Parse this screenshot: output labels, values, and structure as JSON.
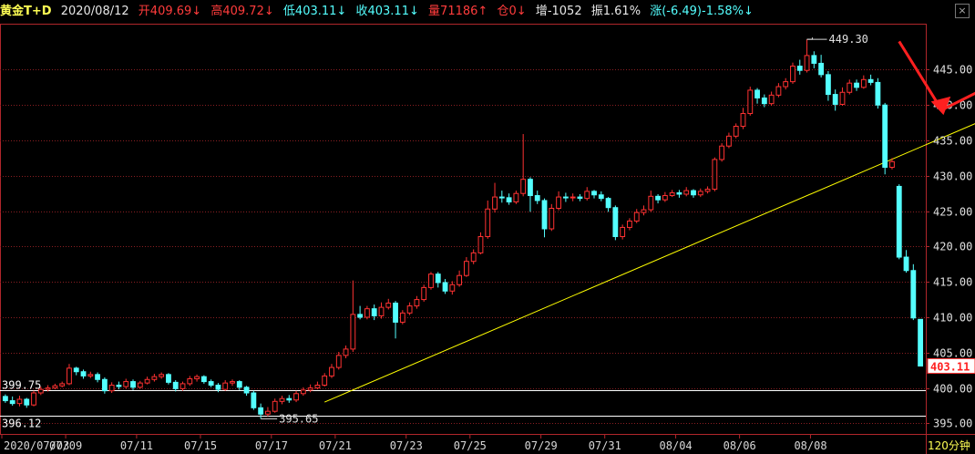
{
  "header": {
    "symbol": "黄金T+D",
    "date": "2020/08/12",
    "open_label": "开",
    "open": "409.69",
    "high_label": "高",
    "high": "409.72",
    "low_label": "低",
    "low": "403.11",
    "close_label": "收",
    "close": "403.11",
    "volume_label": "量",
    "volume": "71186",
    "position_label": "仓",
    "position": "0",
    "increase_label": "增",
    "increase": "-1052",
    "amplitude_label": "振",
    "amplitude": "1.61%",
    "change_label": "涨",
    "change": "(-6.49)-1.58%",
    "up_arrow": "↑",
    "down_arrow": "↓"
  },
  "period_label": "120分钟",
  "colors": {
    "up": "#ff3232",
    "down": "#54ffff",
    "axis": "#b0262b",
    "text_up": "#ff3c3c",
    "text_down": "#54ffff",
    "yellow": "#ffff00"
  },
  "chart_data": {
    "type": "candlestick",
    "period": "120分钟",
    "y_ticks": [
      395,
      400,
      405,
      410,
      415,
      420,
      425,
      430,
      435,
      440,
      445
    ],
    "y_tick_labels": [
      "395.00",
      "400.00",
      "405.00",
      "410.00",
      "415.00",
      "420.00",
      "425.00",
      "430.00",
      "435.00",
      "440.00",
      "445.00"
    ],
    "ylim": [
      393.5,
      451.5
    ],
    "x_labels": [
      "2020/07/03",
      "07/09",
      "07/11",
      "07/15",
      "07/17",
      "07/21",
      "07/23",
      "07/25",
      "07/29",
      "07/31",
      "08/04",
      "08/06",
      "08/08"
    ],
    "x_label_index": [
      0,
      9,
      19,
      28,
      38,
      47,
      57,
      66,
      76,
      85,
      95,
      104,
      114
    ],
    "current_price": "403.11",
    "reference_lines": [
      {
        "value": 399.75,
        "label": "399.75"
      },
      {
        "value": 396.12,
        "label": "396.12"
      }
    ],
    "annotations": [
      {
        "label": "449.30",
        "value": 449.3,
        "type": "max"
      },
      {
        "label": "395.65",
        "value": 395.65,
        "type": "min"
      }
    ],
    "candles": [
      [
        398.8,
        398.2,
        399.1,
        397.9
      ],
      [
        398.2,
        397.8,
        398.8,
        397.5
      ],
      [
        397.8,
        398.4,
        398.9,
        397.4
      ],
      [
        398.4,
        397.6,
        398.6,
        397.2
      ],
      [
        397.6,
        399.3,
        399.6,
        397.4
      ],
      [
        399.3,
        399.8,
        400.2,
        399.0
      ],
      [
        399.8,
        400.0,
        400.4,
        399.5
      ],
      [
        400.0,
        400.3,
        400.6,
        399.8
      ],
      [
        400.3,
        400.6,
        400.9,
        400.1
      ],
      [
        400.6,
        402.8,
        403.4,
        400.4
      ],
      [
        402.8,
        402.3,
        403.0,
        401.8
      ],
      [
        402.3,
        401.7,
        402.6,
        401.3
      ],
      [
        401.7,
        401.9,
        402.3,
        401.4
      ],
      [
        401.9,
        401.2,
        402.2,
        400.8
      ],
      [
        401.2,
        399.6,
        401.5,
        399.2
      ],
      [
        399.6,
        400.4,
        400.8,
        399.3
      ],
      [
        400.4,
        400.2,
        400.9,
        399.8
      ],
      [
        400.2,
        400.9,
        401.3,
        399.9
      ],
      [
        400.9,
        400.1,
        401.2,
        399.7
      ],
      [
        400.1,
        400.7,
        401.0,
        399.9
      ],
      [
        400.7,
        401.2,
        401.6,
        400.5
      ],
      [
        401.2,
        401.6,
        402.0,
        400.9
      ],
      [
        401.6,
        401.9,
        402.2,
        401.3
      ],
      [
        401.9,
        400.8,
        402.1,
        400.5
      ],
      [
        400.8,
        399.9,
        401.1,
        399.5
      ],
      [
        399.9,
        400.6,
        400.9,
        399.6
      ],
      [
        400.6,
        401.3,
        401.7,
        400.3
      ],
      [
        401.3,
        401.6,
        401.9,
        400.9
      ],
      [
        401.6,
        400.9,
        401.8,
        400.6
      ],
      [
        400.9,
        400.4,
        401.2,
        400.1
      ],
      [
        400.4,
        399.8,
        400.7,
        399.4
      ],
      [
        399.8,
        400.7,
        401.1,
        399.6
      ],
      [
        400.7,
        400.9,
        401.2,
        400.3
      ],
      [
        400.9,
        400.1,
        401.1,
        399.7
      ],
      [
        400.1,
        399.3,
        400.3,
        398.9
      ],
      [
        399.3,
        397.2,
        399.6,
        396.9
      ],
      [
        397.2,
        396.3,
        397.8,
        395.65
      ],
      [
        396.3,
        396.7,
        397.3,
        396.0
      ],
      [
        396.7,
        398.1,
        398.5,
        396.5
      ],
      [
        398.1,
        398.5,
        398.9,
        397.7
      ],
      [
        398.5,
        398.3,
        399.0,
        397.9
      ],
      [
        398.3,
        399.2,
        399.6,
        398.0
      ],
      [
        399.2,
        399.7,
        400.1,
        398.9
      ],
      [
        399.7,
        400.0,
        400.5,
        399.4
      ],
      [
        400.0,
        400.4,
        400.9,
        399.8
      ],
      [
        400.4,
        401.7,
        402.1,
        400.2
      ],
      [
        401.7,
        402.9,
        403.4,
        401.4
      ],
      [
        402.9,
        404.6,
        405.1,
        402.6
      ],
      [
        404.6,
        405.5,
        406.0,
        404.2
      ],
      [
        405.5,
        410.4,
        415.2,
        405.1
      ],
      [
        410.4,
        410.0,
        411.6,
        409.7
      ],
      [
        410.0,
        411.2,
        411.6,
        409.7
      ],
      [
        411.2,
        410.2,
        411.8,
        409.6
      ],
      [
        410.2,
        411.4,
        412.1,
        409.8
      ],
      [
        411.4,
        412.0,
        412.6,
        411.1
      ],
      [
        412.0,
        409.3,
        412.3,
        407.0
      ],
      [
        409.3,
        410.6,
        411.0,
        409.0
      ],
      [
        410.6,
        411.6,
        412.1,
        410.3
      ],
      [
        411.6,
        412.5,
        413.0,
        411.2
      ],
      [
        412.5,
        414.2,
        414.6,
        412.2
      ],
      [
        414.2,
        416.1,
        416.4,
        413.9
      ],
      [
        416.1,
        414.9,
        416.4,
        414.2
      ],
      [
        414.9,
        413.7,
        415.4,
        413.3
      ],
      [
        413.7,
        414.6,
        415.1,
        413.2
      ],
      [
        414.6,
        415.9,
        416.6,
        414.3
      ],
      [
        415.9,
        417.9,
        418.5,
        415.7
      ],
      [
        417.9,
        419.1,
        419.6,
        417.5
      ],
      [
        419.1,
        421.4,
        422.0,
        418.9
      ],
      [
        421.4,
        425.3,
        426.5,
        421.1
      ],
      [
        425.3,
        427.0,
        429.0,
        424.8
      ],
      [
        427.0,
        426.9,
        427.9,
        426.2
      ],
      [
        426.9,
        426.3,
        427.5,
        425.9
      ],
      [
        426.3,
        427.5,
        427.9,
        426.0
      ],
      [
        427.5,
        429.5,
        435.9,
        427.1
      ],
      [
        429.5,
        427.2,
        429.8,
        424.9
      ],
      [
        427.2,
        426.5,
        427.9,
        426.0
      ],
      [
        426.5,
        422.5,
        426.8,
        421.3
      ],
      [
        422.5,
        425.4,
        426.0,
        422.2
      ],
      [
        425.4,
        427.0,
        427.8,
        425.1
      ],
      [
        427.0,
        426.9,
        427.6,
        426.3
      ],
      [
        426.9,
        427.0,
        427.5,
        426.4
      ],
      [
        427.0,
        426.8,
        427.4,
        426.4
      ],
      [
        426.8,
        427.8,
        428.4,
        426.5
      ],
      [
        427.8,
        427.3,
        428.0,
        426.8
      ],
      [
        427.3,
        426.8,
        427.8,
        426.4
      ],
      [
        426.8,
        425.5,
        427.0,
        424.9
      ],
      [
        425.5,
        421.4,
        425.8,
        420.9
      ],
      [
        421.4,
        422.7,
        423.1,
        421.0
      ],
      [
        422.7,
        423.6,
        424.0,
        422.3
      ],
      [
        423.6,
        424.8,
        425.3,
        423.3
      ],
      [
        424.8,
        425.2,
        425.8,
        424.4
      ],
      [
        425.2,
        427.1,
        427.9,
        424.9
      ],
      [
        427.1,
        426.6,
        427.4,
        426.1
      ],
      [
        426.6,
        427.2,
        427.7,
        426.3
      ],
      [
        427.2,
        427.6,
        428.0,
        427.0
      ],
      [
        427.6,
        427.4,
        428.0,
        426.9
      ],
      [
        427.4,
        427.9,
        428.4,
        427.1
      ],
      [
        427.9,
        427.3,
        428.1,
        426.9
      ],
      [
        427.3,
        427.8,
        428.2,
        427.0
      ],
      [
        427.8,
        428.1,
        428.5,
        427.5
      ],
      [
        428.1,
        432.3,
        432.6,
        427.8
      ],
      [
        432.3,
        434.2,
        434.6,
        432.0
      ],
      [
        434.2,
        435.6,
        436.1,
        433.9
      ],
      [
        435.6,
        437.0,
        437.4,
        435.3
      ],
      [
        437.0,
        438.8,
        439.6,
        436.6
      ],
      [
        438.8,
        442.1,
        442.6,
        438.5
      ],
      [
        442.1,
        441.0,
        442.4,
        440.2
      ],
      [
        441.0,
        440.2,
        441.5,
        439.7
      ],
      [
        440.2,
        441.4,
        441.9,
        439.9
      ],
      [
        441.4,
        442.6,
        443.1,
        441.1
      ],
      [
        442.6,
        443.3,
        443.8,
        442.2
      ],
      [
        443.3,
        445.5,
        446.0,
        443.0
      ],
      [
        445.5,
        444.9,
        446.4,
        444.3
      ],
      [
        444.9,
        447.0,
        449.3,
        444.6
      ],
      [
        447.0,
        445.9,
        447.6,
        445.2
      ],
      [
        445.9,
        444.3,
        447.1,
        443.9
      ],
      [
        444.3,
        441.5,
        444.8,
        440.6
      ],
      [
        441.5,
        440.1,
        442.2,
        439.2
      ],
      [
        440.1,
        441.8,
        442.5,
        439.9
      ],
      [
        441.8,
        443.1,
        443.6,
        441.5
      ],
      [
        443.1,
        442.5,
        443.6,
        442.0
      ],
      [
        442.5,
        443.6,
        444.2,
        442.3
      ],
      [
        443.6,
        443.2,
        444.3,
        442.8
      ],
      [
        443.2,
        440.0,
        443.8,
        439.5
      ],
      [
        440.0,
        431.2,
        440.3,
        430.2
      ],
      [
        431.2,
        432.0,
        432.5,
        430.9
      ],
      [
        428.5,
        418.5,
        428.8,
        418.2
      ],
      [
        418.5,
        416.6,
        419.5,
        416.3
      ],
      [
        416.6,
        409.9,
        417.5,
        409.6
      ],
      [
        409.7,
        403.1,
        409.7,
        403.1
      ]
    ],
    "trendline": {
      "from": {
        "index": 45,
        "value": 398.0
      },
      "to": {
        "index": 151,
        "value": 443.5
      }
    }
  },
  "annotation_marks": [
    "red-zigzag-arrow",
    "red-down-arrow",
    "red-up-arrow",
    "yellow-ellipse"
  ]
}
